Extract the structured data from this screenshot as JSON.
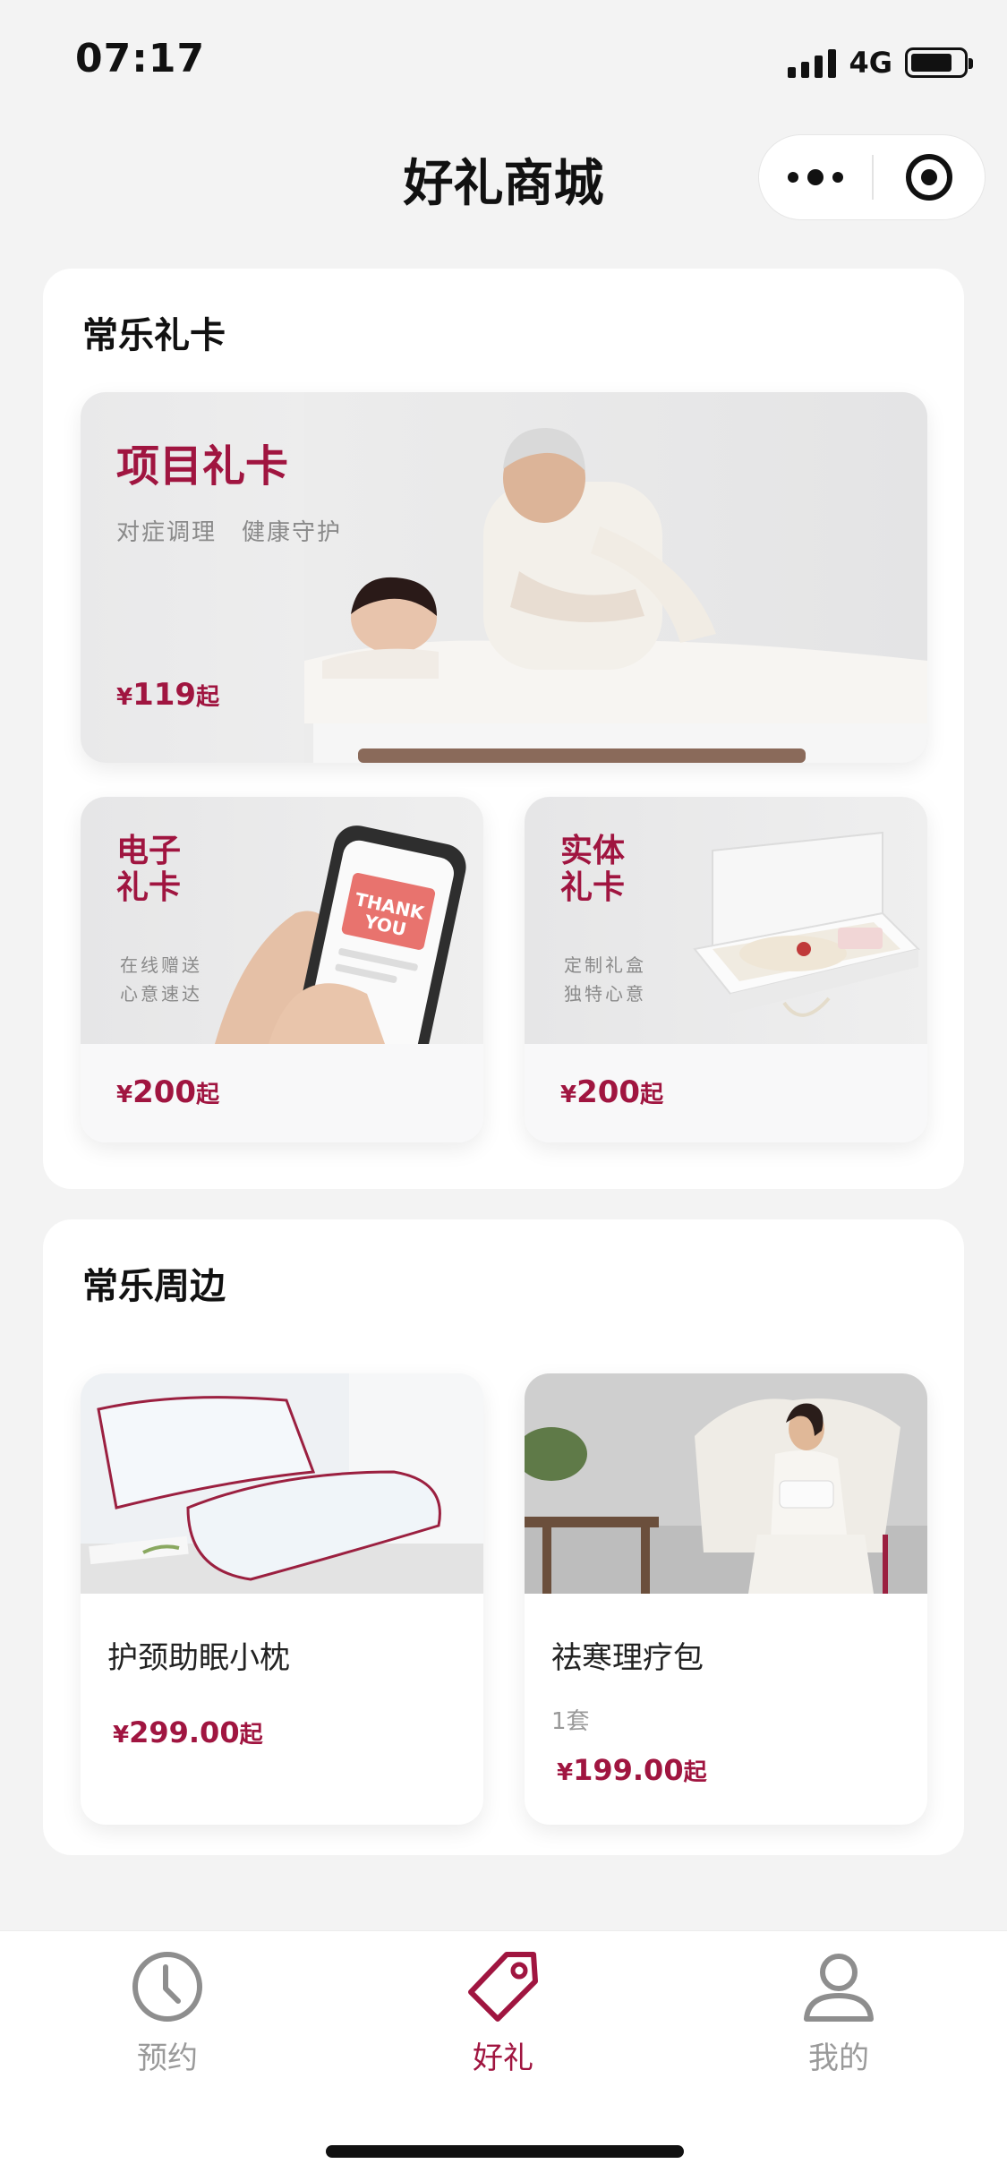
{
  "status_bar": {
    "time": "07:17",
    "network": "4G"
  },
  "nav": {
    "title": "好礼商城"
  },
  "section_cards": {
    "title": "常乐礼卡",
    "banner": {
      "title": "项目礼卡",
      "subtitle": "对症调理　健康守护",
      "price_symbol": "¥",
      "price": "119",
      "price_suffix": "起"
    },
    "e_card": {
      "title_line1": "电子",
      "title_line2": "礼卡",
      "sub_line1": "在线赠送",
      "sub_line2": "心意速达",
      "price_symbol": "¥",
      "price": "200",
      "price_suffix": "起"
    },
    "physical_card": {
      "title_line1": "实体",
      "title_line2": "礼卡",
      "sub_line1": "定制礼盒",
      "sub_line2": "独特心意",
      "price_symbol": "¥",
      "price": "200",
      "price_suffix": "起"
    }
  },
  "section_peripherals": {
    "title": "常乐周边",
    "products": [
      {
        "name": "护颈助眠小枕",
        "price_symbol": "¥",
        "price": "299.00",
        "price_suffix": "起"
      },
      {
        "name": "祛寒理疗包",
        "quantity": "1套",
        "price_symbol": "¥",
        "price": "199.00",
        "price_suffix": "起"
      }
    ]
  },
  "tab_bar": {
    "tabs": [
      {
        "label": "预约",
        "icon": "clock-icon"
      },
      {
        "label": "好礼",
        "icon": "tag-icon"
      },
      {
        "label": "我的",
        "icon": "user-icon"
      }
    ],
    "active_color": "#a01540",
    "inactive_color": "#9a9a9a"
  },
  "colors": {
    "brand": "#a01540",
    "background": "#f3f3f3"
  }
}
